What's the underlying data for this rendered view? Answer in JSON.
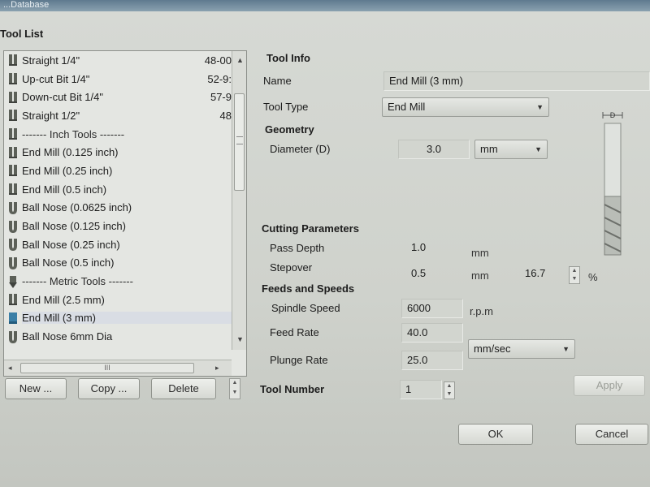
{
  "window": {
    "title": "...Database"
  },
  "tool_list": {
    "heading": "Tool List",
    "items": [
      {
        "label": "Straight 1/4\"",
        "num": "48-00",
        "icon": "straight-bit-icon"
      },
      {
        "label": "Up-cut Bit 1/4\"",
        "num": "52-9:",
        "icon": "straight-bit-icon"
      },
      {
        "label": "Down-cut Bit 1/4\"",
        "num": "57-9",
        "icon": "straight-bit-icon"
      },
      {
        "label": "Straight 1/2\"",
        "num": "48",
        "icon": "straight-bit-icon"
      },
      {
        "label": "------- Inch Tools -------",
        "num": "",
        "icon": "straight-bit-icon",
        "heading": true
      },
      {
        "label": "End Mill (0.125 inch)",
        "num": "",
        "icon": "straight-bit-icon"
      },
      {
        "label": "End Mill (0.25 inch)",
        "num": "",
        "icon": "straight-bit-icon"
      },
      {
        "label": "End Mill (0.5 inch)",
        "num": "",
        "icon": "straight-bit-icon"
      },
      {
        "label": "Ball Nose (0.0625 inch)",
        "num": "",
        "icon": "ball-nose-icon"
      },
      {
        "label": "Ball Nose (0.125 inch)",
        "num": "",
        "icon": "ball-nose-icon"
      },
      {
        "label": "Ball Nose (0.25 inch)",
        "num": "",
        "icon": "ball-nose-icon"
      },
      {
        "label": "Ball Nose (0.5 inch)",
        "num": "",
        "icon": "ball-nose-icon"
      },
      {
        "label": "------- Metric Tools -------",
        "num": "",
        "icon": "v-bit-icon",
        "heading": true
      },
      {
        "label": "End Mill (2.5 mm)",
        "num": "",
        "icon": "straight-bit-icon"
      },
      {
        "label": "End Mill (3 mm)",
        "num": "",
        "icon": "end-mill-selected-icon",
        "selected": true
      },
      {
        "label": "Ball Nose 6mm Dia",
        "num": "",
        "icon": "ball-nose-icon"
      }
    ],
    "hscroll_grip": "III"
  },
  "buttons": {
    "new": "New ...",
    "copy": "Copy ...",
    "delete": "Delete",
    "apply": "Apply",
    "ok": "OK",
    "cancel": "Cancel"
  },
  "tool_info": {
    "heading": "Tool Info",
    "name_label": "Name",
    "name_value": "End Mill (3 mm)",
    "tool_type_label": "Tool Type",
    "tool_type_value": "End Mill"
  },
  "geometry": {
    "heading": "Geometry",
    "diameter_label": "Diameter (D)",
    "diameter_value": "3.0",
    "diameter_unit": "mm"
  },
  "cutting": {
    "heading": "Cutting Parameters",
    "pass_depth_label": "Pass Depth",
    "pass_depth_value": "1.0",
    "pass_depth_unit": "mm",
    "stepover_label": "Stepover",
    "stepover_value": "0.5",
    "stepover_unit": "mm",
    "stepover_percent": "16.7",
    "percent_sign": "%"
  },
  "feeds": {
    "heading": "Feeds and Speeds",
    "spindle_label": "Spindle Speed",
    "spindle_value": "6000",
    "spindle_unit": "r.p.m",
    "feed_label": "Feed Rate",
    "feed_value": "40.0",
    "plunge_label": "Plunge Rate",
    "plunge_value": "25.0",
    "rate_unit": "mm/sec"
  },
  "tool_number": {
    "label": "Tool Number",
    "value": "1"
  },
  "preview": {
    "dimension_label": "D"
  }
}
